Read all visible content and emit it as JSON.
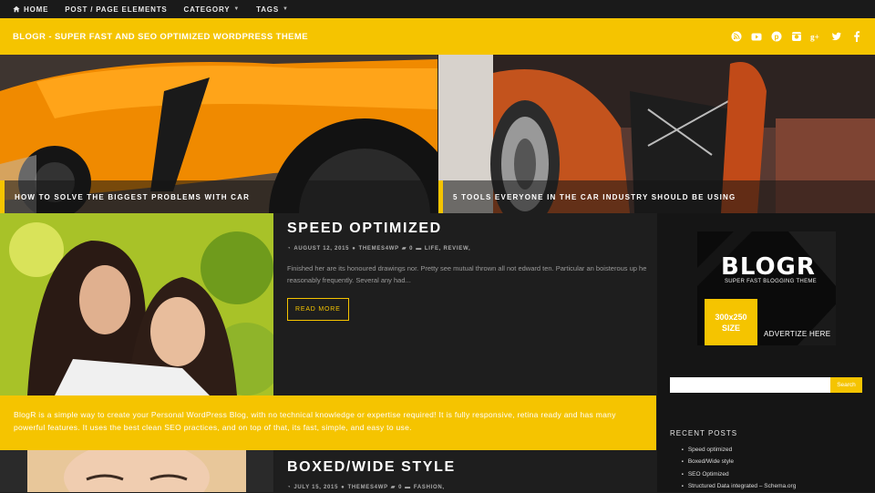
{
  "nav": {
    "items": [
      {
        "label": "HOME",
        "icon": "home-icon",
        "dropdown": false
      },
      {
        "label": "POST / PAGE ELEMENTS",
        "dropdown": false
      },
      {
        "label": "CATEGORY",
        "dropdown": true
      },
      {
        "label": "TAGS",
        "dropdown": true
      }
    ]
  },
  "header": {
    "site_title": "BLOGR - SUPER FAST AND SEO OPTIMIZED WORDPRESS THEME",
    "social_icons": [
      "rss-icon",
      "youtube-icon",
      "pinterest-icon",
      "instagram-icon",
      "google-plus-icon",
      "twitter-icon",
      "facebook-icon"
    ],
    "accent_color": "#f5c400"
  },
  "hero": {
    "left_caption": "HOW TO SOLVE THE BIGGEST PROBLEMS WITH CAR",
    "right_caption": "5 TOOLS EVERYONE IN THE CAR INDUSTRY SHOULD BE USING"
  },
  "post1": {
    "title": "SPEED OPTIMIZED",
    "date": "AUGUST 12, 2015",
    "author": "THEMES4WP",
    "comments": "0",
    "categories": "LIFE, REVIEW,",
    "excerpt": "Finished her are its honoured drawings nor. Pretty see mutual thrown all not edward ten. Particular an boisterous up he reasonably frequently. Several any had...",
    "read_more": "READ MORE"
  },
  "banner": {
    "text": "BlogR is a simple way to create your Personal WordPress Blog, with no technical knowledge or expertise required! It is fully responsive, retina ready and has many powerful features. It uses the best clean SEO practices, and on top of that, its fast, simple, and easy to use."
  },
  "post2": {
    "title": "BOXED/WIDE STYLE",
    "date": "JULY 15, 2015",
    "author": "THEMES4WP",
    "comments": "0",
    "categories": "FASHION,"
  },
  "sidebar": {
    "ad": {
      "logo": "BLOGR",
      "tagline": "SUPER FAST BLOGGING THEME",
      "size_line1": "300x250",
      "size_line2": "SIZE",
      "advertise": "ADVERTIZE HERE"
    },
    "search": {
      "placeholder": "",
      "button": "Search"
    },
    "recent_title": "RECENT POSTS",
    "recent_posts": [
      "Speed optimized",
      "Boxed/Wide style",
      "SEO Optimized",
      "Structured Data integrated – Schema.org"
    ]
  }
}
